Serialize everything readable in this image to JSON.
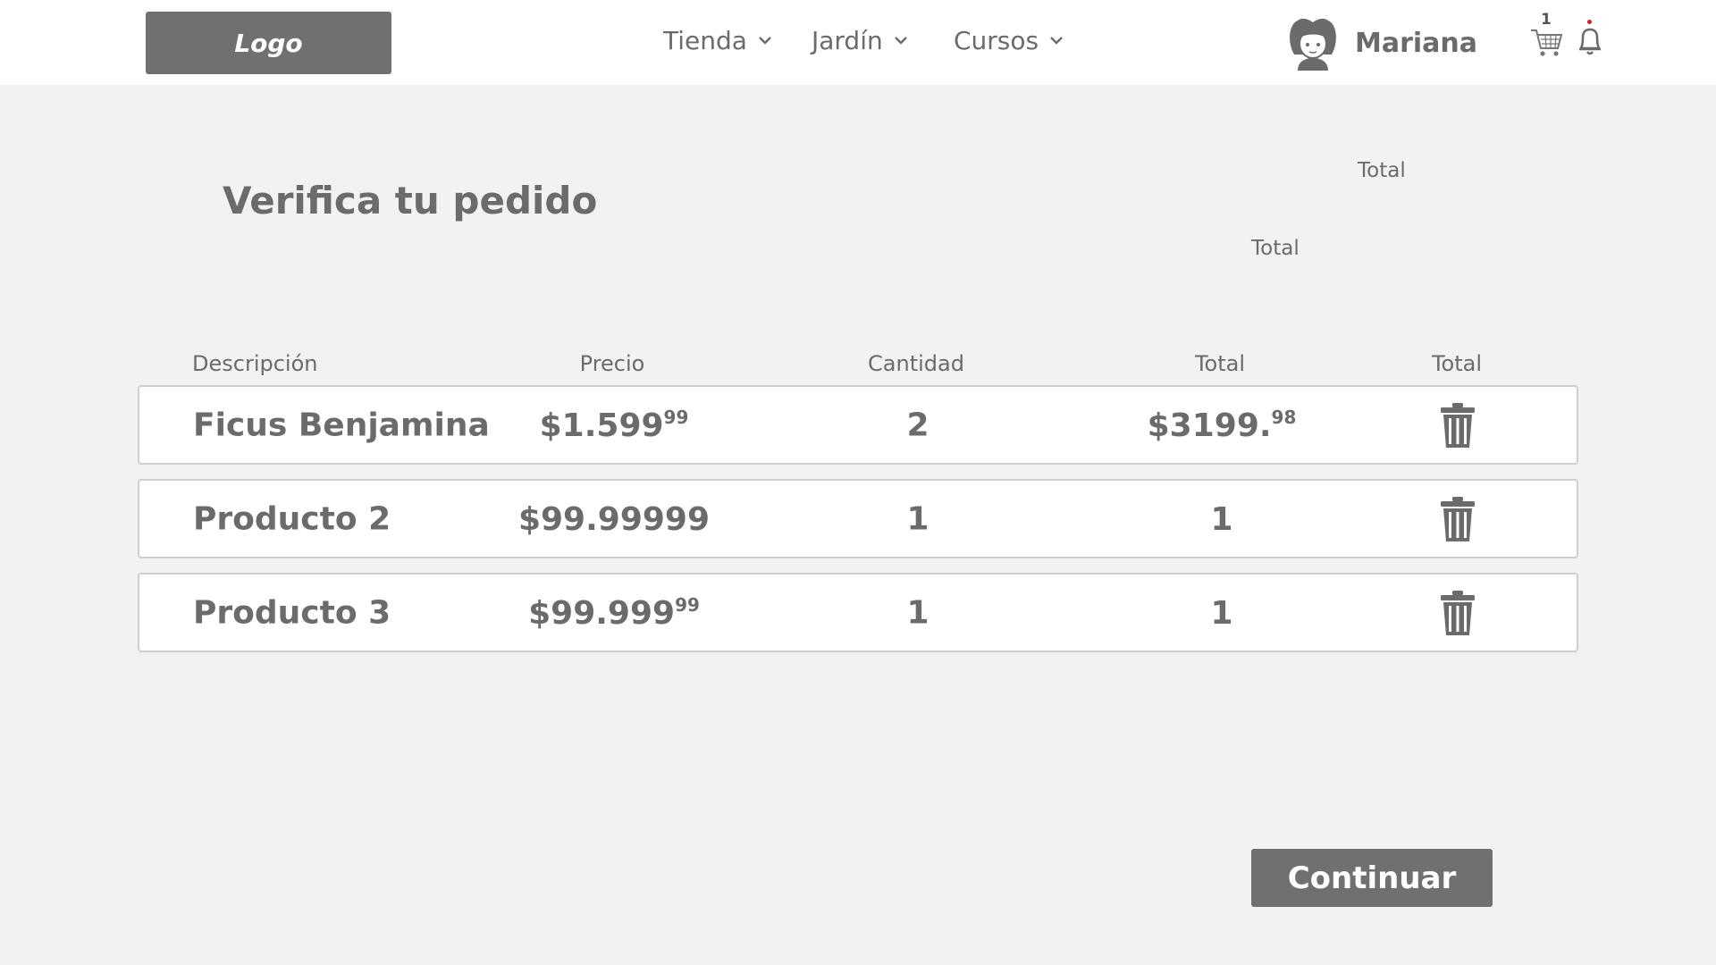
{
  "header": {
    "logo_label": "Logo",
    "nav": [
      {
        "label": "Tienda",
        "icon": "chevron-down-icon"
      },
      {
        "label": "Jardín",
        "icon": "chevron-down-icon"
      },
      {
        "label": "Cursos",
        "icon": "chevron-down-icon"
      }
    ],
    "user": {
      "name": "Mariana",
      "avatar_icon": "girl-avatar-icon"
    },
    "cart": {
      "count": "1",
      "icon": "shopping-cart-icon"
    },
    "notifications": {
      "icon": "bell-icon",
      "dot_color": "#cc2222"
    }
  },
  "main": {
    "title": "Verifica tu pedido",
    "summary_label_top": "Total",
    "summary_label_bottom": "Total"
  },
  "table": {
    "columns": [
      "Descripción",
      "Precio",
      "Cantidad",
      "Total",
      "Total"
    ],
    "rows": [
      {
        "description": "Ficus Benjamina",
        "price_main": "$1.599",
        "price_sup": "99",
        "quantity": "2",
        "total_main": "$3199.",
        "total_sup": "98"
      },
      {
        "description": "Producto 2",
        "price_main": "$99.99999",
        "price_sup": "",
        "quantity": "1",
        "total_main": "1",
        "total_sup": ""
      },
      {
        "description": "Producto 3",
        "price_main": "$99.999",
        "price_sup": "99",
        "quantity": "1",
        "total_main": "1",
        "total_sup": ""
      }
    ],
    "delete_icon": "trash-icon"
  },
  "actions": {
    "continue_label": "Continuar"
  },
  "colors": {
    "primary_gray": "#707070",
    "text_gray": "#6b6b6b",
    "background": "#f2f2f2"
  }
}
